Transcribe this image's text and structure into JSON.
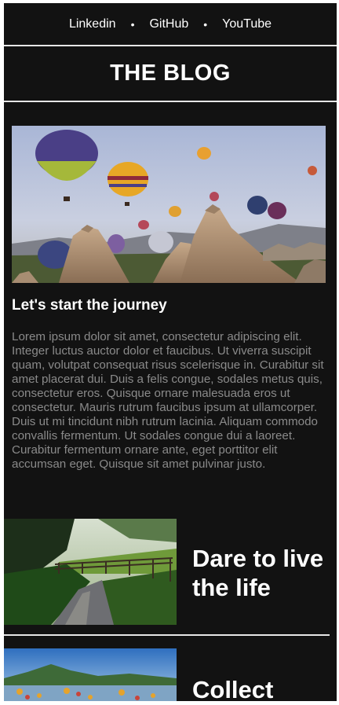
{
  "nav": {
    "items": [
      "Linkedin",
      "GitHub",
      "YouTube"
    ],
    "separator": "•"
  },
  "header": {
    "title": "THE BLOG"
  },
  "featured": {
    "title": "Let's start the journey",
    "body": "Lorem ipsum dolor sit amet, consectetur adipiscing elit. Integer luctus auctor dolor et faucibus. Ut viverra suscipit quam, volutpat consequat risus scelerisque in. Curabitur sit amet placerat dui. Duis a felis congue, sodales metus quis, consectetur eros. Quisque ornare malesuada eros ut consectetur. Mauris rutrum faucibus ipsum at ullamcorper. Duis ut mi tincidunt nibh rutrum lacinia. Aliquam commodo convallis fermentum. Ut sodales congue dui a laoreet. Curabitur fermentum ornare ante, eget porttitor elit accumsan eget. Quisque sit amet pulvinar justo."
  },
  "posts": [
    {
      "title": "Dare to live the life"
    },
    {
      "title": "Collect"
    }
  ],
  "colors": {
    "background": "#121212",
    "text": "#ffffff",
    "muted_text": "#8a8a8a",
    "divider": "#e6e6e6"
  }
}
